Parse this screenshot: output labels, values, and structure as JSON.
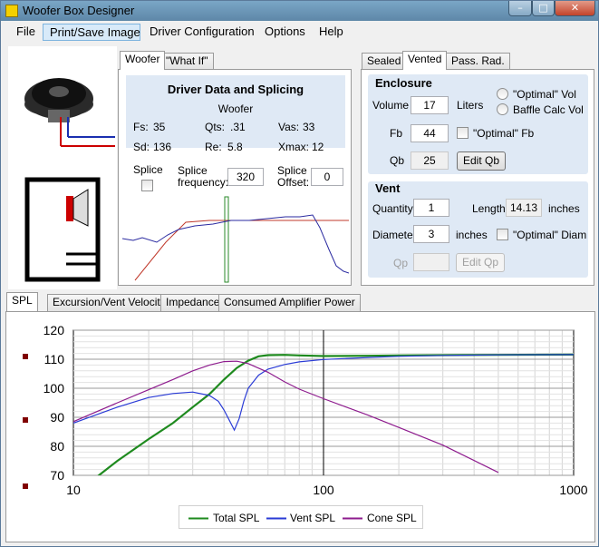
{
  "window": {
    "title": "Woofer Box Designer"
  },
  "menu": [
    "File",
    "Print/Save Image",
    "Driver Configuration",
    "Options",
    "Help"
  ],
  "driver_tabs": [
    "Woofer",
    "\"What If\""
  ],
  "driver": {
    "heading": "Driver Data and Splicing",
    "name": "Woofer",
    "params": [
      {
        "label": "Fs:",
        "value": "35"
      },
      {
        "label": "Qts:",
        "value": ".31"
      },
      {
        "label": "Vas:",
        "value": "33"
      },
      {
        "label": "Sd:",
        "value": "136"
      },
      {
        "label": "Re:",
        "value": "5.8"
      },
      {
        "label": "Xmax:",
        "value": "12"
      }
    ],
    "splice_label": "Splice",
    "splice_freq_label": "Splice\nfrequency:",
    "splice_freq_l1": "Splice",
    "splice_freq_l2": "frequency:",
    "splice_freq_value": "320",
    "splice_offset_l1": "Splice",
    "splice_offset_l2": "Offset:",
    "splice_offset_value": "0"
  },
  "enclosure_tabs": [
    "Sealed",
    "Vented",
    "Pass. Rad."
  ],
  "enclosure": {
    "title": "Enclosure",
    "volume_label": "Volume",
    "volume_value": "17",
    "volume_unit": "Liters",
    "optimal_vol": "\"Optimal\" Vol",
    "baffle_calc": "Baffle Calc Vol",
    "fb_label": "Fb",
    "fb_value": "44",
    "optimal_fb": "\"Optimal\" Fb",
    "qb_label": "Qb",
    "qb_value": "25",
    "edit_qb": "Edit Qb"
  },
  "vent": {
    "title": "Vent",
    "quantity_label": "Quantity",
    "quantity_value": "1",
    "length_label": "Length",
    "length_value": "14.13",
    "length_unit": "inches",
    "diameter_label": "Diameter",
    "diameter_value": "3",
    "diameter_unit": "inches",
    "optimal_diam": "\"Optimal\" Diam",
    "qp_label": "Qp",
    "edit_qp": "Edit Qp"
  },
  "graph_tabs": [
    "SPL",
    "Excursion/Vent Velocity",
    "Impedance",
    "Consumed Amplifier Power"
  ],
  "colors": {
    "total": "#1e8a1e",
    "vent": "#2a3bd6",
    "cone": "#8e1c8e",
    "splice_red": "#c0392b"
  },
  "chart_data": {
    "type": "line",
    "x_scale": "log",
    "xlim": [
      10,
      1000
    ],
    "ylim": [
      70,
      120
    ],
    "x_ticks": [
      "10",
      "100",
      "1000"
    ],
    "y_ticks": [
      "120",
      "110",
      "100",
      "90",
      "80",
      "70"
    ],
    "legend_position": "bottom",
    "grid": true,
    "series": [
      {
        "name": "Total SPL",
        "color": "#1e8a1e",
        "x": [
          10,
          12,
          15,
          20,
          25,
          30,
          35,
          40,
          45,
          50,
          55,
          60,
          70,
          80,
          100,
          150,
          200,
          300,
          500,
          1000
        ],
        "y": [
          62,
          68.5,
          75,
          82.5,
          88,
          93.5,
          98,
          103,
          107,
          109.5,
          111,
          111.4,
          111.5,
          111.3,
          111.1,
          111.2,
          111.3,
          111.4,
          111.5,
          111.6
        ]
      },
      {
        "name": "Vent SPL",
        "color": "#2a3bd6",
        "x": [
          10,
          12,
          15,
          20,
          25,
          30,
          35,
          38,
          40,
          42,
          44,
          46,
          48,
          50,
          55,
          60,
          70,
          80,
          100,
          150,
          200,
          300,
          500,
          1000
        ],
        "y": [
          88,
          90.5,
          93.5,
          96.8,
          98.2,
          98.7,
          97.5,
          95.5,
          92.5,
          89,
          85.6,
          89.5,
          95.5,
          100,
          104.5,
          106.6,
          108.2,
          109.1,
          109.9,
          110.6,
          111,
          111.3,
          111.5,
          111.6
        ]
      },
      {
        "name": "Cone SPL",
        "color": "#8e1c8e",
        "x": [
          10,
          15,
          20,
          25,
          30,
          35,
          40,
          45,
          50,
          60,
          70,
          80,
          100,
          150,
          200,
          300,
          500
        ],
        "y": [
          88.5,
          95,
          99.5,
          103,
          106,
          108,
          109.2,
          109.3,
          108.5,
          105.5,
          102.2,
          99.7,
          96.4,
          90.8,
          86.5,
          80.4,
          71
        ]
      }
    ]
  }
}
